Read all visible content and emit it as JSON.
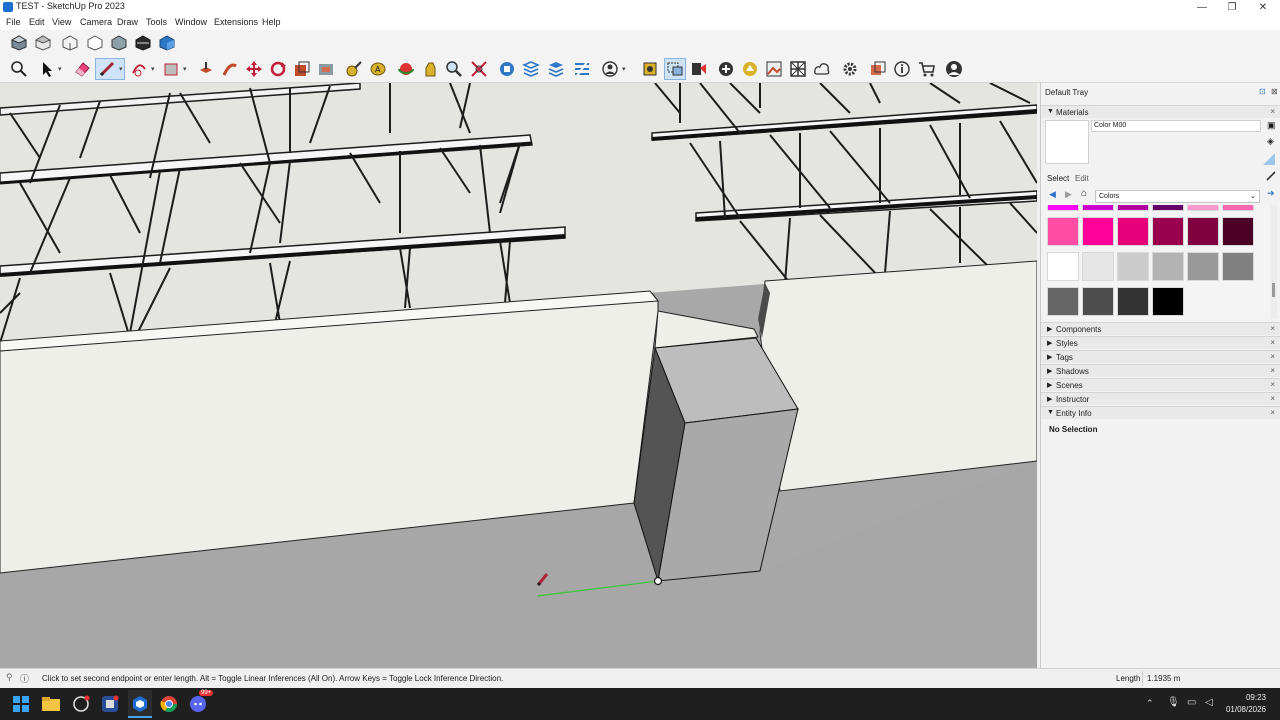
{
  "window": {
    "title": "TEST - SketchUp Pro 2023",
    "minimize": "—",
    "maximize": "❐",
    "close": "✕"
  },
  "menu": {
    "items": [
      "File",
      "Edit",
      "View",
      "Camera",
      "Draw",
      "Tools",
      "Window",
      "Extensions",
      "Help"
    ]
  },
  "tray": {
    "title": "Default Tray",
    "materials_header": "Materials",
    "material_name": "Color M00",
    "tab_select": "Select",
    "tab_edit": "Edit",
    "library_value": "Colors",
    "swatch_colors": [
      "#ff00ff",
      "#cc00cc",
      "#b000a0",
      "#660066",
      "#ff99cc",
      "#ff66b2",
      "#ff4da6",
      "#ff0099",
      "#e6007a",
      "#99004d",
      "#800040",
      "#4d0026",
      "#ffffff",
      "#e6e6e6",
      "#cccccc",
      "#b3b3b3",
      "#999999",
      "#808080",
      "#666666",
      "#4d4d4d",
      "#333333",
      "#000000"
    ],
    "panels": [
      "Components",
      "Styles",
      "Tags",
      "Shadows",
      "Scenes",
      "Instructor",
      "Entity Info"
    ],
    "entity_info_text": "No Selection"
  },
  "status": {
    "message": "Click to set second endpoint or enter length.  Alt = Toggle Linear Inferences (All On).  Arrow Keys = Toggle Lock Inference Direction.",
    "measure_label": "Length",
    "measure_value": "1.1935 m"
  },
  "taskbar": {
    "time": "09:23",
    "date": "01/08/2026",
    "badge": "99+",
    "icons": [
      "windows-start-icon",
      "file-explorer-icon",
      "app-icon",
      "chatgpt-icon",
      "sketchup-icon",
      "chrome-icon",
      "discord-icon"
    ]
  },
  "colors": {
    "accent": "#1f6fd1",
    "viewport_ground": "#a8a8a8",
    "wall_face": "#efefea",
    "inference_green": "#3cc63c"
  }
}
